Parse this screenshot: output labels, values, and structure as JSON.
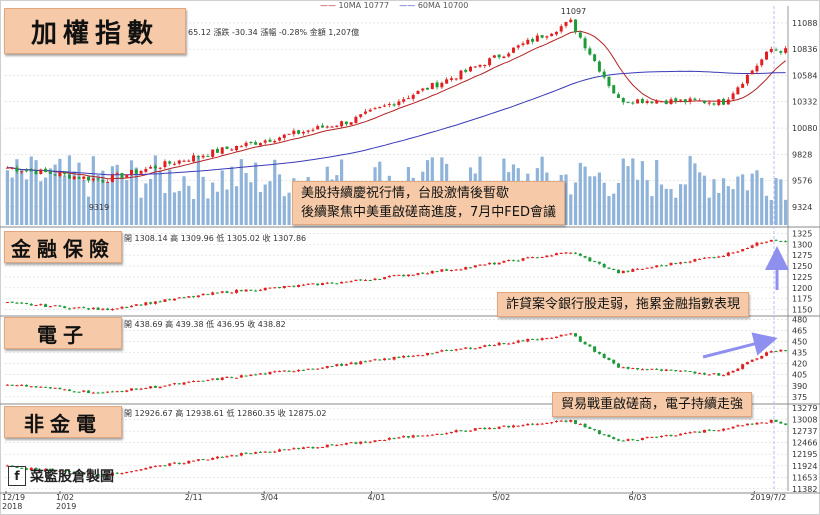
{
  "ma_legend": {
    "ma10": "10MA 10777",
    "ma60": "60MA 10700"
  },
  "colors": {
    "up": "#e02020",
    "down": "#1f9a3b",
    "ma10": "#b22222",
    "ma60": "#3b3bb8",
    "volume": "#8fb3d9",
    "accent": "#8f8fef",
    "grid": "#d8d8d8",
    "label_bg": "#f6caa8"
  },
  "panels": [
    {
      "label": "加權指數",
      "header": "65.12  漲跌 -30.34  漲幅 -0.28%  金額 1,207億"
    },
    {
      "label": "金融保險",
      "header": "開 1308.14  高 1309.96  低 1305.02  收 1307.86"
    },
    {
      "label": "電子",
      "header": "開 438.69  高 439.38  低 436.95  收 438.82"
    },
    {
      "label": "非金電",
      "header": "開 12926.67  高 12938.61  低 12860.35  收 12875.02"
    }
  ],
  "annotations": [
    {
      "lines": [
        "美股持續慶祝行情，台股激情後暫歇",
        "後續聚焦中美重啟磋商進度，7月中FED會議"
      ]
    },
    {
      "lines": [
        "詐貸案令銀行股走弱，拖累金融指數表現"
      ]
    },
    {
      "lines": [
        "貿易戰重啟磋商，電子持續走強"
      ]
    }
  ],
  "logo": {
    "icon": "facebook-icon",
    "text": "菜籃股倉製圖"
  },
  "chart_data": [
    {
      "type": "candlestick",
      "title": "加權指數",
      "x_ticks": [
        "12/19\n2018",
        "1/02\n2019",
        "2/11",
        "3/04",
        "4/01",
        "5/02",
        "6/03",
        "2019/7/2"
      ],
      "y_ticks": [
        9324,
        9576,
        9828,
        10080,
        10332,
        10584,
        10836,
        11088
      ],
      "ylim": [
        9150,
        11250
      ],
      "peak_label": "11097",
      "trough_label": "9319",
      "series": [
        {
          "name": "10MA 10777",
          "kind": "line"
        },
        {
          "name": "60MA 10700",
          "kind": "line"
        },
        {
          "name": "",
          "kind": "volume"
        }
      ],
      "anchors_x": [
        0,
        20,
        45,
        72,
        95,
        118,
        128,
        150,
        160,
        163
      ],
      "anchors_y": [
        9700,
        9580,
        9870,
        10150,
        10600,
        11097,
        10350,
        10330,
        10836,
        10820
      ]
    },
    {
      "type": "candlestick",
      "title": "金融保險",
      "y_ticks": [
        1150,
        1175,
        1200,
        1225,
        1250,
        1275,
        1300,
        1325
      ],
      "ylim": [
        1140,
        1335
      ],
      "anchors_x": [
        0,
        20,
        45,
        72,
        95,
        118,
        128,
        150,
        160,
        163
      ],
      "anchors_y": [
        1165,
        1150,
        1190,
        1215,
        1245,
        1282,
        1235,
        1275,
        1312,
        1307
      ]
    },
    {
      "type": "candlestick",
      "title": "電子",
      "y_ticks": [
        375,
        390,
        405,
        420,
        435,
        450,
        465,
        480
      ],
      "ylim": [
        368,
        482
      ],
      "anchors_x": [
        0,
        20,
        45,
        72,
        95,
        118,
        128,
        150,
        160,
        163
      ],
      "anchors_y": [
        392,
        380,
        400,
        420,
        440,
        460,
        415,
        405,
        438,
        439
      ]
    },
    {
      "type": "candlestick",
      "title": "非金電",
      "y_ticks": [
        11382,
        11653,
        11924,
        12195,
        12466,
        12737,
        13008,
        13279
      ],
      "ylim": [
        11330,
        13330
      ],
      "anchors_x": [
        0,
        20,
        45,
        72,
        95,
        118,
        128,
        150,
        160,
        163
      ],
      "anchors_y": [
        11900,
        11700,
        12150,
        12450,
        12750,
        12980,
        12500,
        12800,
        12980,
        12875
      ]
    }
  ]
}
